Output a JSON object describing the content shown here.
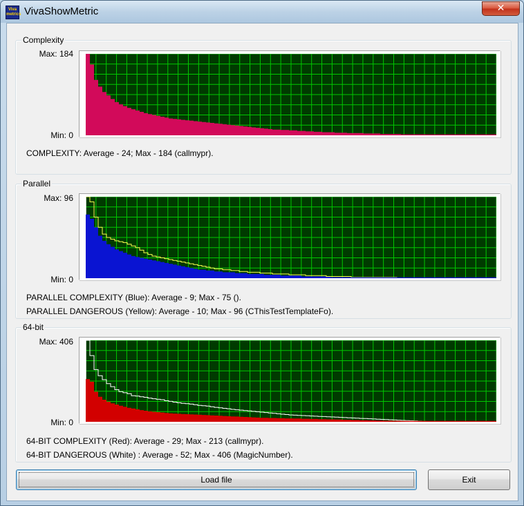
{
  "window": {
    "title": "VivaShowMetric",
    "icon_text": "Viva metrics",
    "close_glyph": "✕"
  },
  "colors": {
    "plot_bg": "#003a00",
    "grid": "#00c800",
    "complexity_fill": "#d20a5a",
    "parallel_fill": "#0a14d2",
    "parallel_line": "#ffff50",
    "bit64_fill": "#d20000",
    "bit64_line": "#ffffff"
  },
  "groups": [
    {
      "label": "Complexity",
      "max_label": "Max: 184",
      "min_label": "Min: 0",
      "stats": [
        "COMPLEXITY: Average - 24;  Max - 184 (callmypr)."
      ]
    },
    {
      "label": "Parallel",
      "max_label": "Max: 96",
      "min_label": "Min: 0",
      "stats": [
        "PARALLEL COMPLEXITY (Blue): Average - 9;  Max - 75 ().",
        "PARALLEL DANGEROUS (Yellow): Average - 10;  Max - 96 (CThisTestTemplateFo)."
      ]
    },
    {
      "label": "64-bit",
      "max_label": "Max: 406",
      "min_label": "Min: 0",
      "stats": [
        "64-BIT COMPLEXITY (Red): Average - 29;  Max - 213 (callmypr).",
        "64-BIT DANGEROUS (White) : Average - 52;  Max - 406 (MagicNumber)."
      ]
    }
  ],
  "buttons": {
    "load": "Load file",
    "exit": "Exit"
  },
  "chart_data": [
    {
      "type": "area",
      "name_ref": "Complexity",
      "ylim": [
        0,
        184
      ],
      "x_count": 100,
      "series": [
        {
          "color": "#d20a5a",
          "kind": "area",
          "values": [
            184,
            160,
            125,
            110,
            98,
            90,
            82,
            75,
            70,
            66,
            62,
            59,
            56,
            53,
            50,
            48,
            46,
            44,
            42,
            40,
            38,
            37,
            36,
            35,
            34,
            33,
            32,
            31,
            30,
            29,
            28,
            27,
            26,
            25,
            24,
            23,
            22,
            21,
            20,
            19,
            18,
            17,
            16,
            15,
            14,
            13,
            13,
            12,
            12,
            11,
            11,
            10,
            10,
            9,
            9,
            8,
            8,
            7,
            7,
            7,
            6,
            6,
            6,
            5,
            5,
            5,
            5,
            4,
            4,
            4,
            4,
            3,
            3,
            3,
            3,
            3,
            2,
            2,
            2,
            2,
            2,
            2,
            1,
            1,
            1,
            1,
            1,
            1,
            1,
            1,
            0,
            0,
            0,
            0,
            0,
            0,
            0,
            0,
            0,
            0
          ]
        }
      ]
    },
    {
      "type": "area",
      "name_ref": "Parallel",
      "ylim": [
        0,
        96
      ],
      "x_count": 100,
      "series": [
        {
          "color": "#0a14d2",
          "kind": "area",
          "values": [
            75,
            70,
            60,
            50,
            44,
            40,
            37,
            34,
            32,
            30,
            28,
            26,
            25,
            24,
            23,
            22,
            21,
            20,
            19,
            18,
            17,
            16,
            15,
            14,
            13,
            12,
            11,
            10,
            10,
            9,
            9,
            8,
            8,
            7,
            7,
            7,
            6,
            6,
            6,
            5,
            5,
            5,
            5,
            4,
            4,
            4,
            4,
            3,
            3,
            3,
            3,
            3,
            2,
            2,
            2,
            2,
            2,
            2,
            2,
            1,
            1,
            1,
            1,
            1,
            1,
            1,
            1,
            1,
            1,
            1,
            0,
            0,
            0,
            0,
            0,
            0,
            0,
            0,
            0,
            0,
            0,
            0,
            0,
            0,
            0,
            0,
            0,
            0,
            0,
            0,
            0,
            0,
            0,
            0,
            0,
            0,
            0,
            0,
            0,
            0
          ]
        },
        {
          "color": "#ffff50",
          "kind": "line",
          "values": [
            96,
            90,
            72,
            60,
            52,
            48,
            46,
            44,
            43,
            42,
            40,
            38,
            36,
            33,
            30,
            28,
            26,
            25,
            24,
            23,
            22,
            21,
            20,
            19,
            18,
            17,
            16,
            15,
            14,
            13,
            12,
            11,
            11,
            10,
            10,
            9,
            9,
            8,
            8,
            7,
            7,
            7,
            6,
            6,
            6,
            5,
            5,
            5,
            5,
            4,
            4,
            4,
            4,
            3,
            3,
            3,
            3,
            3,
            2,
            2,
            2,
            2,
            2,
            2,
            1,
            1,
            1,
            1,
            1,
            1,
            1,
            1,
            1,
            1,
            1,
            0,
            0,
            0,
            0,
            0,
            0,
            0,
            0,
            0,
            0,
            0,
            0,
            0,
            0,
            0,
            0,
            0,
            0,
            0,
            0,
            0,
            0,
            0,
            0,
            0
          ]
        }
      ]
    },
    {
      "type": "area",
      "name_ref": "64-bit",
      "ylim": [
        0,
        406
      ],
      "x_count": 100,
      "series": [
        {
          "color": "#d20000",
          "kind": "area",
          "values": [
            213,
            200,
            150,
            125,
            110,
            100,
            92,
            86,
            80,
            75,
            70,
            66,
            62,
            58,
            55,
            52,
            50,
            48,
            46,
            44,
            42,
            41,
            40,
            39,
            38,
            37,
            36,
            35,
            34,
            33,
            32,
            31,
            30,
            29,
            28,
            27,
            26,
            25,
            24,
            23,
            22,
            21,
            20,
            20,
            19,
            19,
            18,
            18,
            17,
            17,
            16,
            16,
            15,
            15,
            14,
            14,
            13,
            13,
            12,
            12,
            11,
            11,
            10,
            10,
            9,
            9,
            8,
            8,
            7,
            7,
            6,
            6,
            5,
            5,
            4,
            4,
            3,
            3,
            2,
            2,
            1,
            1,
            1,
            1,
            1,
            1,
            1,
            1,
            0,
            0,
            0,
            0,
            0,
            0,
            0,
            0,
            0,
            0,
            0,
            0
          ]
        },
        {
          "color": "#ffffff",
          "kind": "line",
          "values": [
            406,
            330,
            260,
            230,
            210,
            190,
            175,
            160,
            150,
            145,
            140,
            130,
            128,
            125,
            122,
            118,
            115,
            112,
            110,
            105,
            102,
            98,
            95,
            92,
            90,
            88,
            85,
            82,
            80,
            78,
            75,
            72,
            70,
            67,
            65,
            62,
            60,
            58,
            56,
            54,
            52,
            50,
            48,
            46,
            44,
            42,
            40,
            38,
            36,
            34,
            33,
            32,
            31,
            30,
            29,
            28,
            27,
            26,
            25,
            24,
            23,
            22,
            21,
            20,
            19,
            18,
            17,
            16,
            15,
            14,
            13,
            12,
            11,
            10,
            9,
            8,
            7,
            6,
            5,
            4,
            3,
            2,
            1,
            0,
            0,
            0,
            0,
            0,
            0,
            0,
            0,
            0,
            0,
            0,
            0,
            0,
            0,
            0,
            0,
            0
          ]
        }
      ]
    }
  ]
}
